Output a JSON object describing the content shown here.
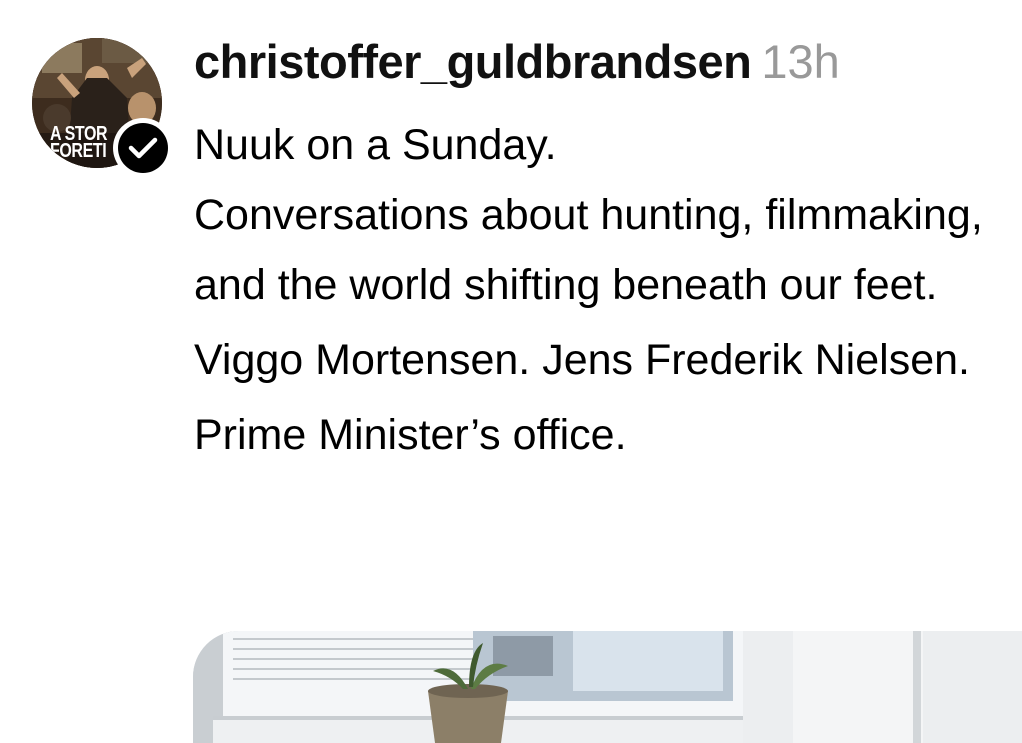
{
  "post": {
    "username": "christoffer_guldbrandsen",
    "timestamp": "13h",
    "avatar_text": "A STOR\nFORET",
    "verified_badge": "checkmark-icon",
    "caption": [
      "Nuuk on a Sunday.",
      "Conversations about hunting, filmmaking, and the world shifting beneath our feet.",
      "Viggo Mortensen. Jens Frederik Nielsen.",
      "Prime Minister’s office."
    ],
    "photo": "window-with-plant-photo"
  },
  "colors": {
    "background": "#ffffff",
    "text": "#000000",
    "timestamp": "#999999",
    "badge": "#000000"
  }
}
